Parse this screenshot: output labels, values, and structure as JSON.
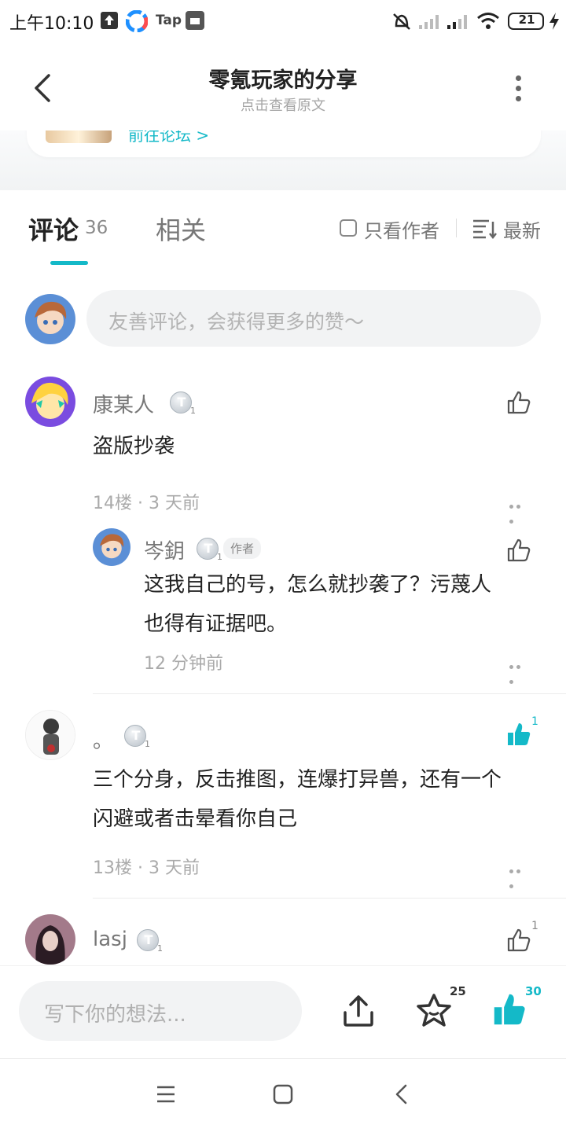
{
  "status_bar": {
    "time": "上午10:10",
    "tap_label": "Tap",
    "battery": "21"
  },
  "header": {
    "title": "零氪玩家的分享",
    "subtitle": "点击查看原文"
  },
  "forum_card": {
    "link_label": "前往论坛 >"
  },
  "tabs": {
    "comments_label": "评论",
    "comments_count": "36",
    "related_label": "相关",
    "author_only_label": "只看作者",
    "sort_label": "最新"
  },
  "comment_input": {
    "placeholder": "友善评论，会获得更多的赞～"
  },
  "comments": [
    {
      "user": "康某人",
      "level": "1",
      "text": "盗版抄袭",
      "meta": "14楼 · 3 天前",
      "likes": "",
      "reply": {
        "user": "岑鈅",
        "level": "1",
        "tag": "作者",
        "text_line1": "这我自己的号，怎么就抄袭了？污蔑人",
        "text_line2": "也得有证据吧。",
        "meta": "12 分钟前"
      }
    },
    {
      "user": "。",
      "level": "1",
      "text_line1": "三个分身，反击推图，连爆打异兽，还有一个",
      "text_line2": "闪避或者击晕看你自己",
      "meta": "13楼 · 3 天前",
      "likes": "1"
    },
    {
      "user": "lasj",
      "level": "1",
      "likes": "1"
    }
  ],
  "bottom_bar": {
    "write_placeholder": "写下你的想法...",
    "favorite_count": "25",
    "like_count": "30"
  },
  "colors": {
    "accent": "#14b9c8",
    "text": "#222222",
    "muted": "#aaaaaa"
  }
}
